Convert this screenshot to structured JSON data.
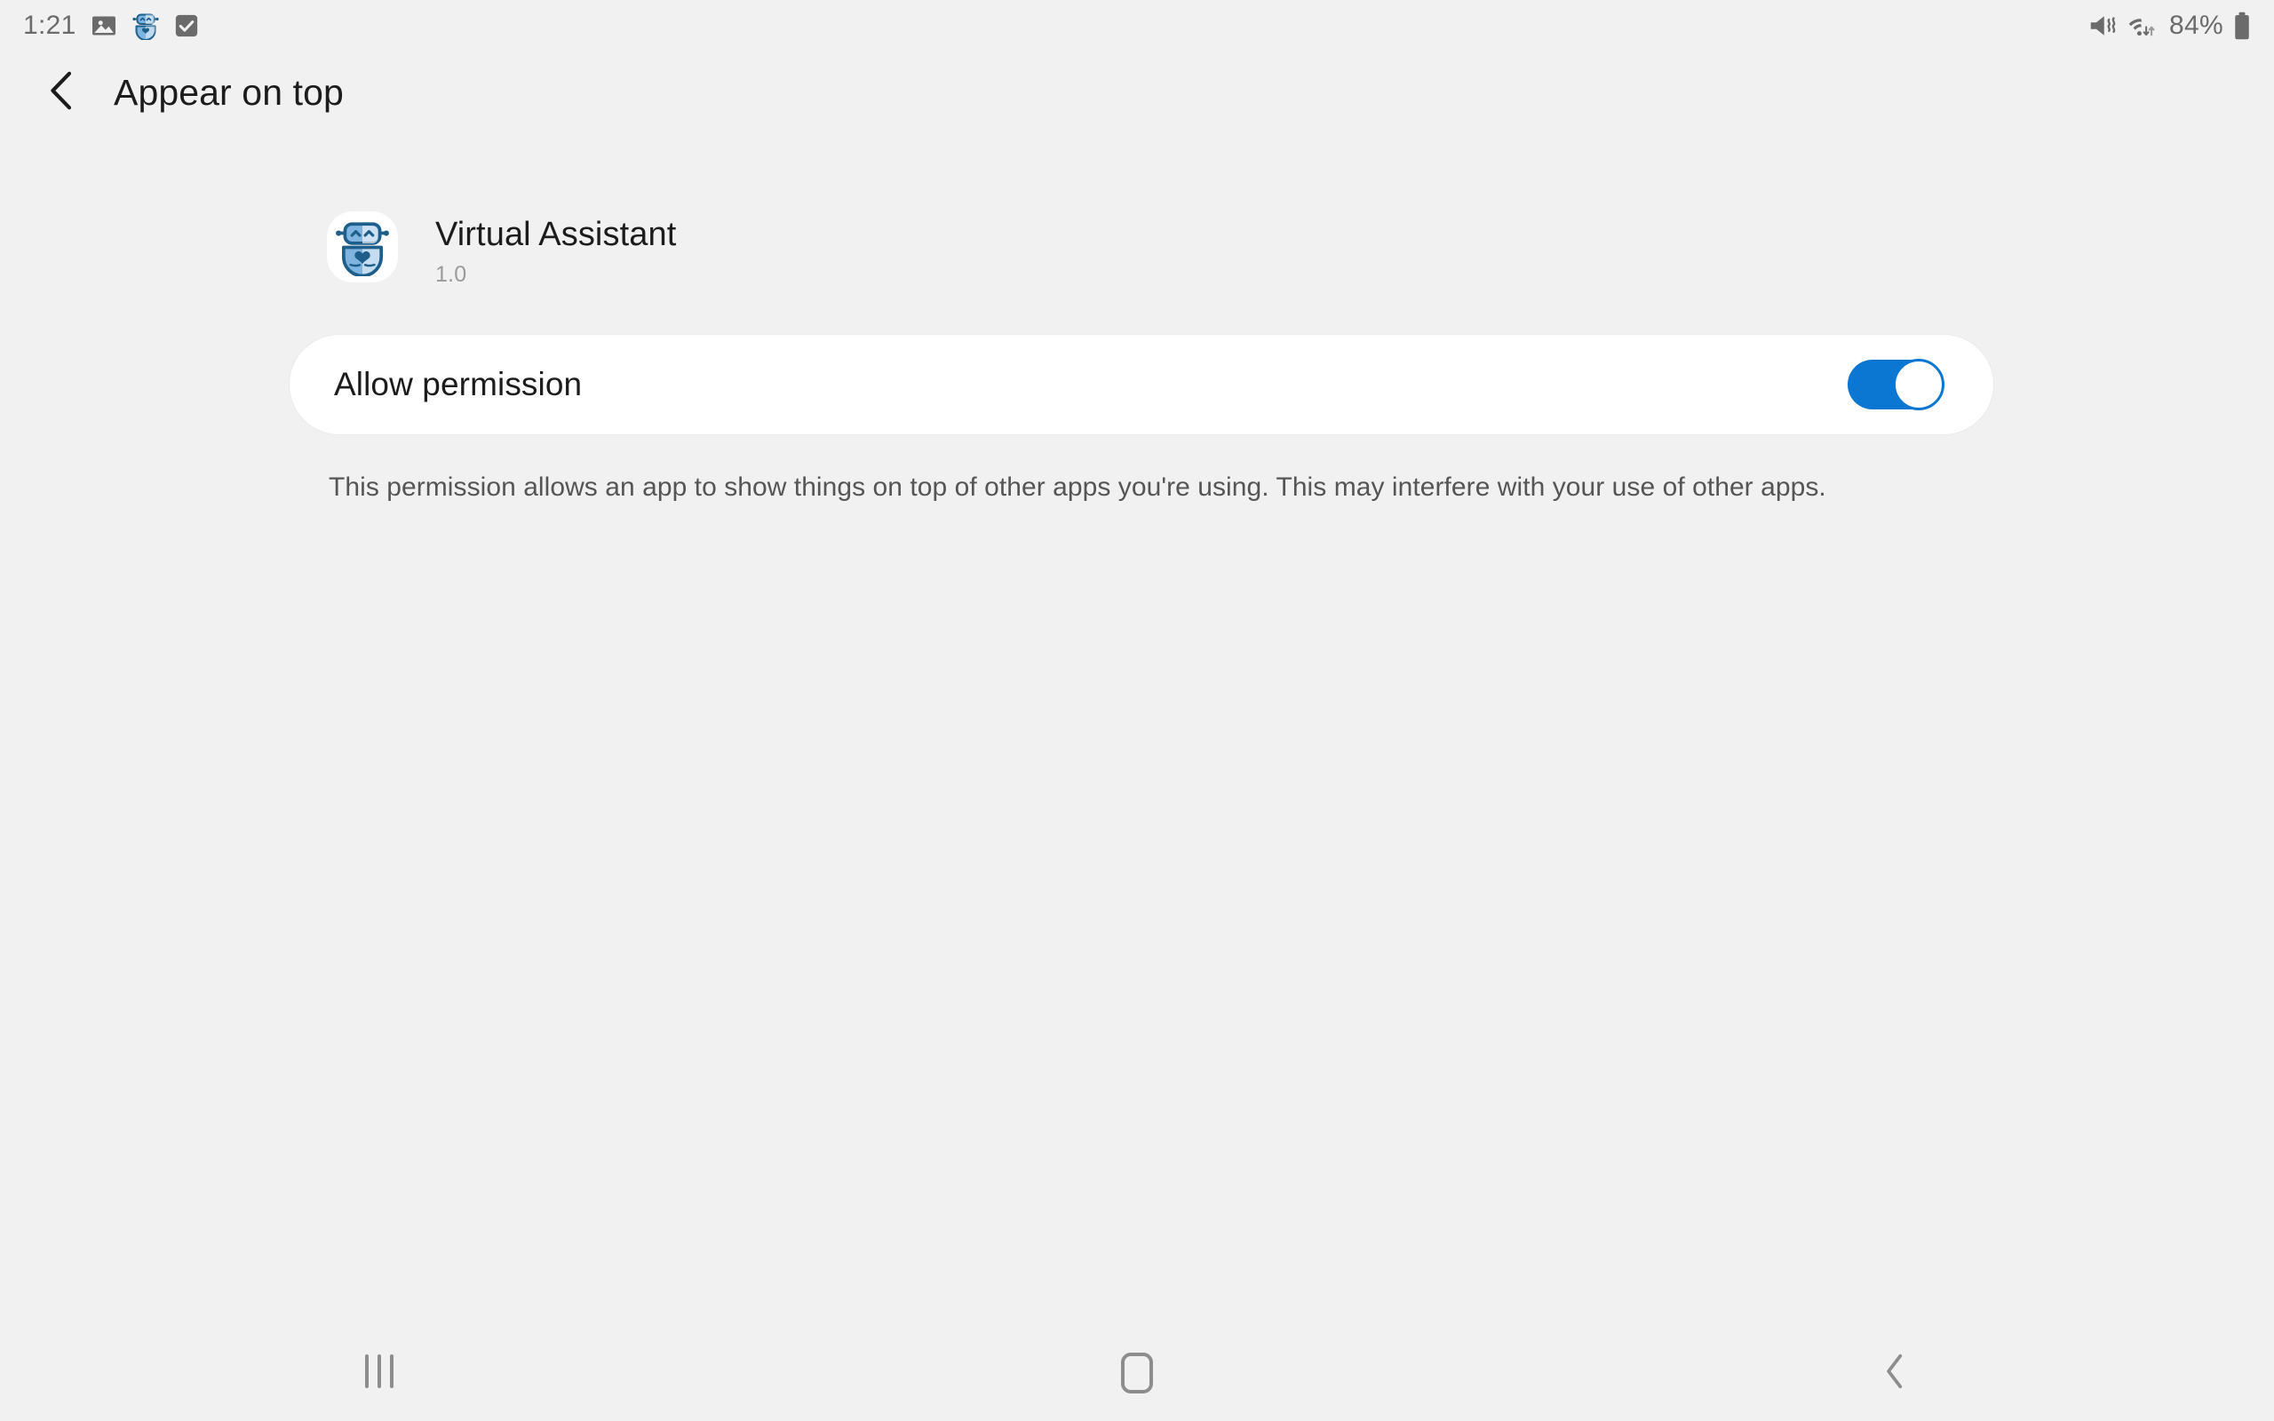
{
  "status_bar": {
    "clock": "1:21",
    "battery_percent": "84%",
    "icons_left": [
      "gallery-image-icon",
      "virtual-assistant-app-icon",
      "checkbox-checked-icon"
    ],
    "icons_right": [
      "mute-vibrate-icon",
      "wifi-data-transfer-icon",
      "battery-icon"
    ]
  },
  "header": {
    "back_icon": "chevron-left-icon",
    "title": "Appear on top"
  },
  "app": {
    "icon": "robot-assistant-icon",
    "name": "Virtual Assistant",
    "version": "1.0"
  },
  "permission": {
    "label": "Allow permission",
    "toggle_state": "on",
    "description": "This permission allows an app to show things on top of other apps you're using. This may interfere with your use of other apps."
  },
  "nav_bar": {
    "recents_label": "recents-icon",
    "home_label": "home-icon",
    "back_label": "back-icon"
  },
  "colors": {
    "background": "#f1f1f1",
    "card": "#ffffff",
    "accent": "#0c77d3",
    "primary_text": "#1c1c1c",
    "secondary_text": "#555555",
    "muted_text": "#9b9b9b",
    "nav_icon": "#8d8d8d",
    "status_icon": "#6b6b6b",
    "app_icon_dark": "#1d5f8a",
    "app_icon_light": "#7fb3e0"
  }
}
